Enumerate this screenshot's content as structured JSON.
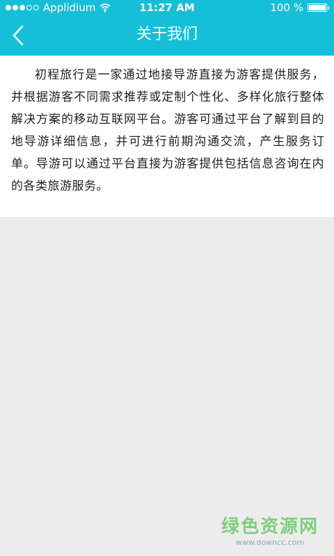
{
  "status_bar": {
    "carrier": "Applidium",
    "time": "11:27 AM",
    "battery": "100 %",
    "signal_bars_filled": 3,
    "signal_bars_total": 5,
    "battery_level": 1.0
  },
  "nav": {
    "title": "关于我们",
    "back_icon": "chevron-left-icon"
  },
  "about": {
    "text": "初程旅行是一家通过地接导游直接为游客提供服务，并根据游客不同需求推荐或定制个性化、多样化旅行整体解决方案的移动互联网平台。游客可通过平台了解到目的地导游详细信息，并可进行前期沟通交流，产生服务订单。导游可以通过平台直接为游客提供包括信息咨询在内的各类旅游服务。"
  },
  "watermark": {
    "title": "绿色资源网",
    "url": "www.downcc.com"
  },
  "colors": {
    "header": "#15bfd8",
    "background": "#ececec",
    "content_bg": "#ffffff",
    "text": "#222222"
  }
}
